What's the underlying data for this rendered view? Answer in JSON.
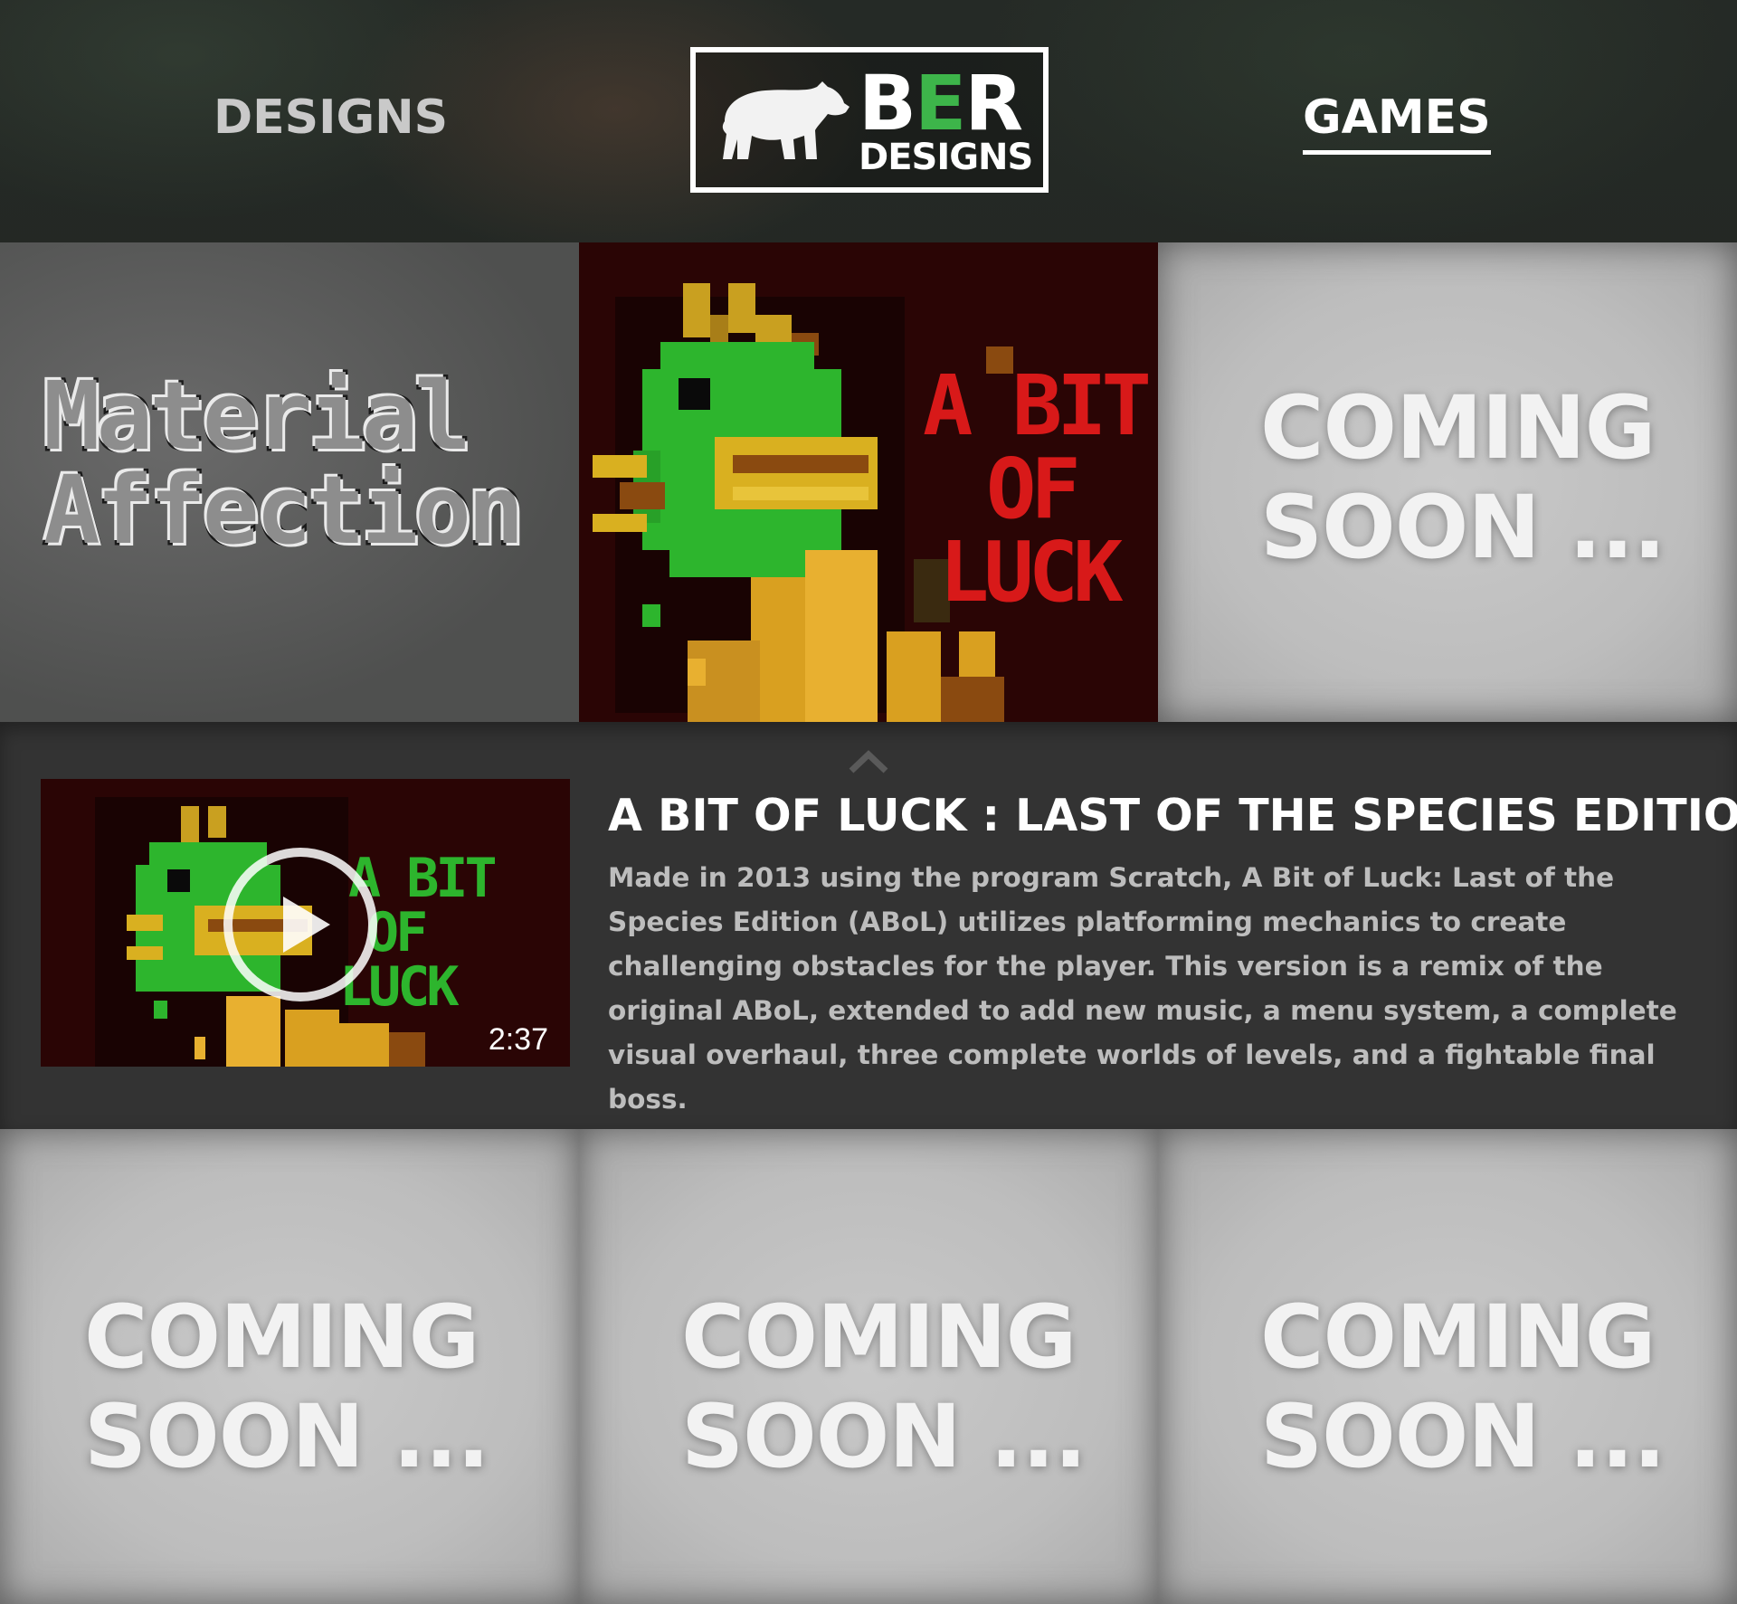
{
  "header": {
    "nav_left": "DESIGNS",
    "nav_right": "GAMES",
    "logo": {
      "line1_a": "B",
      "line1_b": "E",
      "line1_c": "R",
      "line2": "DESIGNS"
    }
  },
  "tiles": {
    "material_affection": {
      "line1": "Material",
      "line2": "Affection"
    },
    "a_bit_of_luck": {
      "line1": "A BIT",
      "line2": "OF",
      "line3": "LUCK"
    },
    "coming_soon": {
      "line1": "COMING",
      "line2": "SOON ..."
    }
  },
  "detail": {
    "title": "A BIT OF LUCK : LAST OF THE SPECIES EDITION",
    "description": "Made in 2013 using the program Scratch, A Bit of Luck: Last of the Species Edition (ABoL) utilizes platforming mechanics to create challenging obstacles for the player. This version is a remix of the original ABoL, extended to add new music, a menu system, a complete visual overhaul, three complete worlds of levels, and a fightable final boss.",
    "video": {
      "duration": "2:37",
      "thumb_line1": "A BIT",
      "thumb_line2": "OF",
      "thumb_line3": "LUCK"
    }
  },
  "colors": {
    "accent_green": "#3db54a",
    "luck_red": "#d81919",
    "panel_bg": "#333333"
  },
  "icons": {
    "logo_mark": "bear-icon",
    "collapse": "chevron-up-icon",
    "video_play": "play-icon"
  }
}
